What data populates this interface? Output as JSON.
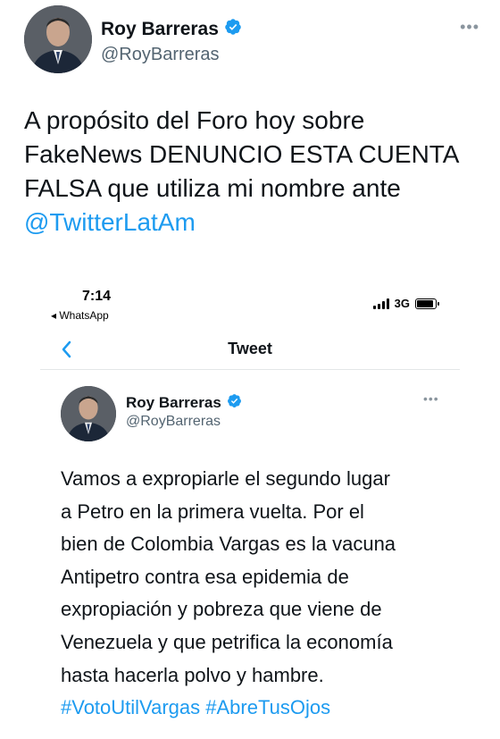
{
  "tweet": {
    "author_name": "Roy Barreras",
    "author_handle": "@RoyBarreras",
    "more_label": "•••",
    "text_lines": [
      "A propósito del Foro hoy sobre",
      "FakeNews DENUNCIO ESTA CUENTA",
      "FALSA que utiliza mi nombre ante"
    ],
    "mention": "@TwitterLatAm"
  },
  "embedded_screenshot": {
    "status_bar": {
      "time": "7:14",
      "back_app": "◂ WhatsApp",
      "network": "3G",
      "battery_level": 0.9
    },
    "nav": {
      "back_icon": "chevron-left-icon",
      "title": "Tweet"
    },
    "tweet": {
      "author_name": "Roy Barreras",
      "author_handle": "@RoyBarreras",
      "more_label": "•••",
      "text_lines": [
        "Vamos a expropiarle el segundo lugar",
        "a Petro en la primera vuelta.  Por el",
        "bien de Colombia Vargas es la vacuna",
        "Antipetro contra esa epidemia de",
        "expropiación y pobreza que viene de",
        "Venezuela y que petrifica la economía",
        "hasta hacerla polvo y hambre."
      ],
      "hashtags": [
        "#VotoUtilVargas",
        "#AbreTusOjos"
      ]
    }
  },
  "colors": {
    "link": "#1d9bf0",
    "text": "#0f1419",
    "secondary": "#536471"
  }
}
